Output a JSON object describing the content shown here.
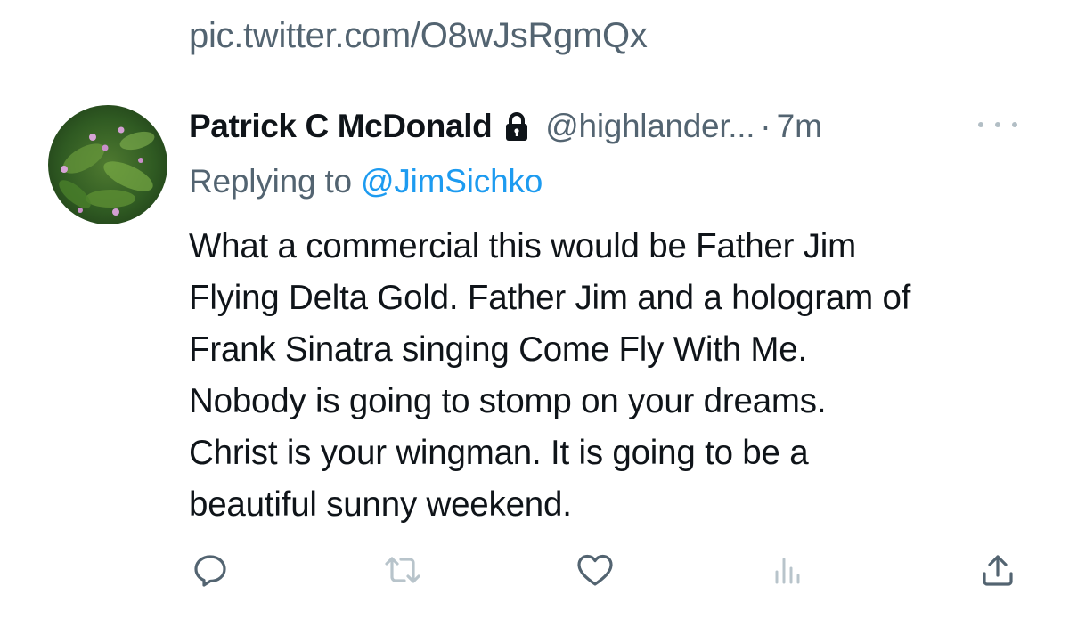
{
  "previous_tweet": {
    "link_text": "pic.twitter.com/O8wJsRgmQx"
  },
  "tweet": {
    "author_name": "Patrick C McDonald",
    "handle": "@highlander...",
    "separator": "·",
    "time": "7m",
    "replying_prefix": "Replying to ",
    "replying_to": "@JimSichko",
    "lines": [
      "What a commercial this would be Father Jim",
      "Flying Delta Gold. Father Jim and a hologram of",
      "Frank Sinatra singing Come Fly With Me.",
      "Nobody is going to stomp on your dreams.",
      "Christ is your wingman. It is going to be a",
      "beautiful sunny weekend."
    ]
  },
  "icons": {
    "lock": "lock-icon",
    "more": "more-icon",
    "reply": "reply-icon",
    "retweet": "retweet-icon",
    "like": "like-icon",
    "views": "views-icon",
    "share": "share-icon"
  },
  "colors": {
    "text_primary": "#0f1419",
    "text_secondary": "#536471",
    "link": "#1d9bf0",
    "retweet_disabled": "#b8c4cb"
  }
}
